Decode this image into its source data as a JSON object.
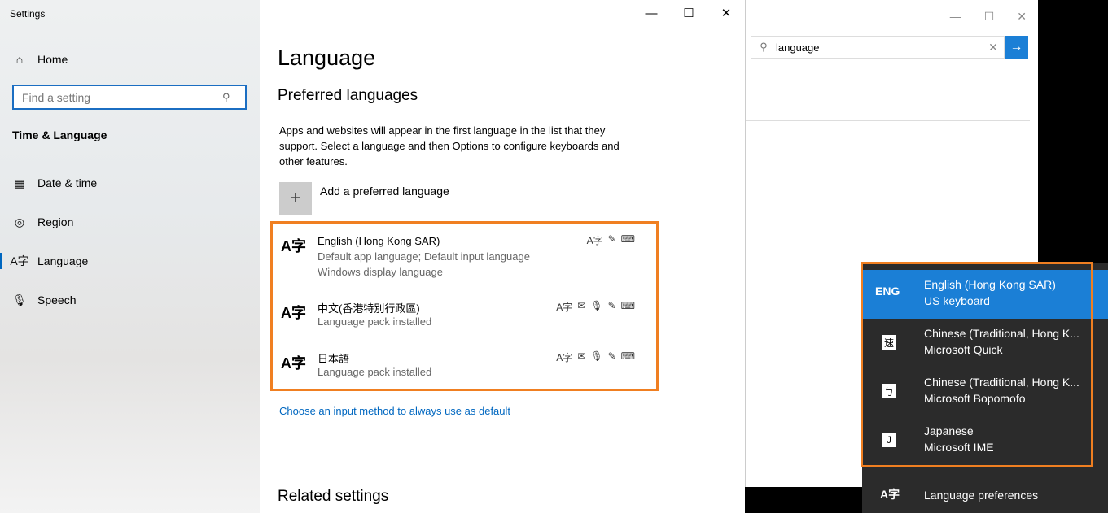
{
  "settings": {
    "app_title": "Settings",
    "nav": {
      "home": "Home",
      "search_placeholder": "Find a setting",
      "section": "Time & Language",
      "items": [
        {
          "label": "Date & time",
          "icon": "calendar-clock-icon"
        },
        {
          "label": "Region",
          "icon": "globe-icon"
        },
        {
          "label": "Language",
          "icon": "language-icon"
        },
        {
          "label": "Speech",
          "icon": "microphone-icon"
        }
      ]
    },
    "main": {
      "title": "Language",
      "preferred_heading": "Preferred languages",
      "description": "Apps and websites will appear in the first language in the list that they support. Select a language and then Options to configure keyboards and other features.",
      "add_label": "Add a preferred language",
      "languages": [
        {
          "name": "English (Hong Kong SAR)",
          "line1": "Default app language; Default input language",
          "line2": "Windows display language"
        },
        {
          "name": "中文(香港特別行政區)",
          "line1": "Language pack installed"
        },
        {
          "name": "日本語",
          "line1": "Language pack installed"
        }
      ],
      "default_input_link": "Choose an input method to always use as default",
      "related_heading": "Related settings"
    }
  },
  "search_window": {
    "query": "language"
  },
  "flyout": {
    "items": [
      {
        "code": "ENG",
        "title": "English (Hong Kong SAR)",
        "subtitle": "US keyboard"
      },
      {
        "glyph": "速",
        "title": "Chinese (Traditional, Hong K...",
        "subtitle": "Microsoft Quick"
      },
      {
        "glyph": "ㄅ",
        "title": "Chinese (Traditional, Hong K...",
        "subtitle": "Microsoft Bopomofo"
      },
      {
        "glyph": "J",
        "title": "Japanese",
        "subtitle": "Microsoft IME"
      }
    ],
    "preferences_label": "Language preferences"
  },
  "colors": {
    "accent": "#0067c0",
    "highlight": "#f07f21",
    "flyout_selected": "#1b7fd6"
  }
}
